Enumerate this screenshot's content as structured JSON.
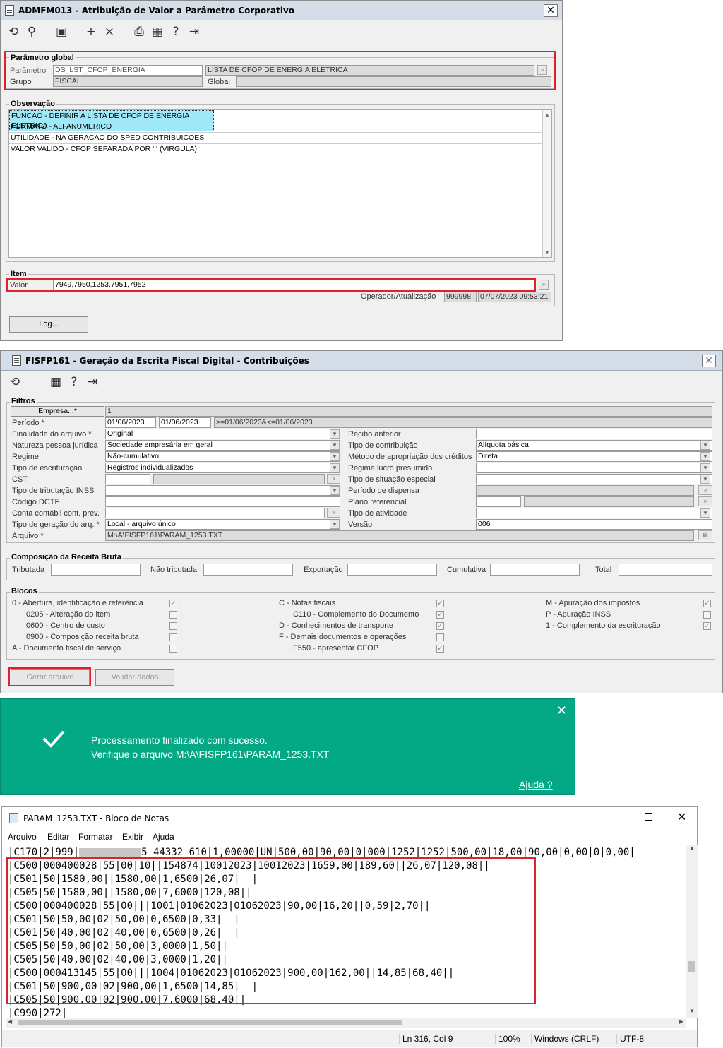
{
  "win1": {
    "title": "ADMFM013 - Atribuição de Valor a Parâmetro Corporativo",
    "close": "✕",
    "param_global": {
      "title": "Parâmetro global",
      "parametro_label": "Parâmetro",
      "parametro_value": "DS_LST_CFOP_ENERGIA",
      "descricao_value": "LISTA DE CFOP DE ENERGIA ELETRICA",
      "grupo_label": "Grupo",
      "grupo_value": "FISCAL",
      "global_label": "Global"
    },
    "observacao": {
      "title": "Observação",
      "lines": [
        "FUNCAO - DEFINIR A LISTA DE CFOP DE ENERGIA ELETRICA",
        "FORMATO - ALFANUMERICO",
        "UTILIDADE - NA GERACAO DO SPED CONTRIBUICOES",
        "VALOR VALIDO - CFOP SEPARADA POR ',' (VIRGULA)"
      ]
    },
    "item": {
      "title": "Item",
      "valor_label": "Valor",
      "valor_value": "7949,7950,1253,7951,7952",
      "operador_label": "Operador/Atualização",
      "operador_value": "999998",
      "data_value": "07/07/2023 09:53:21"
    },
    "log_button": "Log..."
  },
  "win2": {
    "title": "FISFP161 - Geração da Escrita Fiscal Digital - Contribuições",
    "filtros": {
      "title": "Filtros",
      "empresa_button": "Empresa...*",
      "empresa_value": "1",
      "periodo_label": "Período *",
      "periodo_ini": "01/06/2023",
      "periodo_fim": "01/06/2023",
      "periodo_expr": ">=01/06/2023&<=01/06/2023",
      "finalidade_label": "Finalidade do arquivo *",
      "finalidade_value": "Original",
      "natureza_label": "Natureza pessoa jurídica",
      "natureza_value": "Sociedade empresária em geral",
      "regime_label": "Regime",
      "regime_value": "Não-cumulativo",
      "escrituracao_label": "Tipo de escrituração",
      "escrituracao_value": "Registros individualizados",
      "cst_label": "CST",
      "inss_label": "Tipo de tributação INSS",
      "dctf_label": "Código DCTF",
      "conta_label": "Conta contábil cont. prev.",
      "geracao_label": "Tipo de geração do arq. *",
      "geracao_value": "Local - arquivo único",
      "arquivo_label": "Arquivo *",
      "arquivo_value": "M:\\A\\FISFP161\\PARAM_1253.TXT",
      "recibo_label": "Recibo anterior",
      "contribuicao_label": "Tipo de contribuição",
      "contribuicao_value": "Alíquota básica",
      "metodo_label": "Método de apropriação dos créditos",
      "metodo_value": "Direta",
      "lucro_label": "Regime lucro presumido",
      "situacao_label": "Tipo de situação especial",
      "dispensa_label": "Período de dispensa",
      "plano_label": "Plano referencial",
      "atividade_label": "Tipo de atividade",
      "versao_label": "Versão",
      "versao_value": "006"
    },
    "receita": {
      "title": "Composição da Receita Bruta",
      "tributada": "Tributada",
      "nao_tributada": "Não tributada",
      "exportacao": "Exportação",
      "cumulativa": "Cumulativa",
      "total": "Total"
    },
    "blocos": {
      "title": "Blocos",
      "col1": [
        {
          "label": "0 - Abertura, identificação e referência",
          "checked": true
        },
        {
          "label": "0205 - Alteração do item",
          "checked": false
        },
        {
          "label": "0600 - Centro de custo",
          "checked": false
        },
        {
          "label": "0900 - Composição receita bruta",
          "checked": false
        },
        {
          "label": "A - Documento fiscal de serviço",
          "checked": false
        }
      ],
      "col2": [
        {
          "label": "C - Notas fiscais",
          "checked": true
        },
        {
          "label": "C110 - Complemento do Documento",
          "checked": true
        },
        {
          "label": "D - Conhecimentos de transporte",
          "checked": true
        },
        {
          "label": "F - Demais documentos e operações",
          "checked": false
        },
        {
          "label": "F550 - apresentar CFOP",
          "checked": true
        }
      ],
      "col3": [
        {
          "label": "M - Apuração dos impostos",
          "checked": true
        },
        {
          "label": "P - Apuração INSS",
          "checked": false
        },
        {
          "label": "1 - Complemento da escrituração",
          "checked": true
        }
      ]
    },
    "gerar_button": "Gerar arquivo",
    "validar_button": "Validar dados"
  },
  "toast": {
    "line1": "Processamento finalizado com sucesso.",
    "line2": "Verifique o arquivo M:\\A\\FISFP161\\PARAM_1253.TXT",
    "help": "Ajuda ?",
    "close": "✕",
    "color": "#03a884"
  },
  "notepad": {
    "title": "PARAM_1253.TXT - Bloco de Notas",
    "menu": [
      "Arquivo",
      "Editar",
      "Formatar",
      "Exibir",
      "Ajuda"
    ],
    "lines": [
      "|C170|2|999|",
      "|C500|000400028|55|00|10||154874|10012023|10012023|1659,00|189,60||26,07|120,08||",
      "|C501|50|1580,00||1580,00|1,6500|26,07|  |",
      "|C505|50|1580,00||1580,00|7,6000|120,08||",
      "|C500|000400028|55|00|||1001|01062023|01062023|90,00|16,20||0,59|2,70||",
      "|C501|50|50,00|02|50,00|0,6500|0,33|  |",
      "|C501|50|40,00|02|40,00|0,6500|0,26|  |",
      "|C505|50|50,00|02|50,00|3,0000|1,50||",
      "|C505|50|40,00|02|40,00|3,0000|1,20||",
      "|C500|000413145|55|00|||1004|01062023|01062023|900,00|162,00||14,85|68,40||",
      "|C501|50|900,00|02|900,00|1,6500|14,85|  |",
      "|C505|50|900,00|02|900,00|7,6000|68,40||",
      "|C990|272|"
    ],
    "first_line_tail": "5 44332 610|1,00000|UN|500,00|90,00|0|000|1252|1252|500,00|18,00|90,00|0,00|0|0,00|",
    "status": {
      "pos": "Ln 316, Col 9",
      "zoom": "100%",
      "eol": "Windows (CRLF)",
      "enc": "UTF-8"
    }
  }
}
